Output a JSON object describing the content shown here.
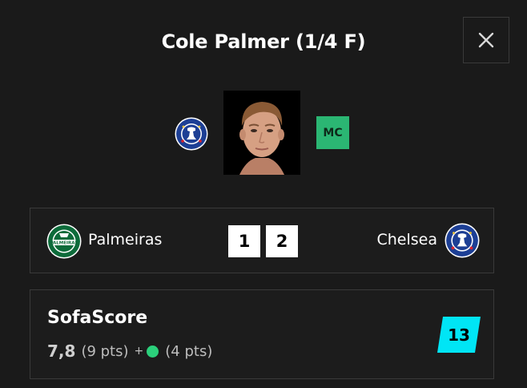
{
  "header": {
    "title": "Cole Palmer (1/4 F)"
  },
  "player": {
    "position": "MC",
    "position_color": "#2bb673"
  },
  "match": {
    "home_team": "Palmeiras",
    "away_team": "Chelsea",
    "home_score": "1",
    "away_score": "2",
    "home_crest_icon": "palmeiras-crest-icon",
    "away_crest_icon": "chelsea-crest-icon"
  },
  "rating": {
    "title": "SofaScore",
    "value": "7,8",
    "value_points": "(9 pts)",
    "plus": "+",
    "bonus_points": "(4 pts)",
    "total_points": "13",
    "badge_color": "#00e5f5",
    "dot_color": "#2bd07b"
  }
}
